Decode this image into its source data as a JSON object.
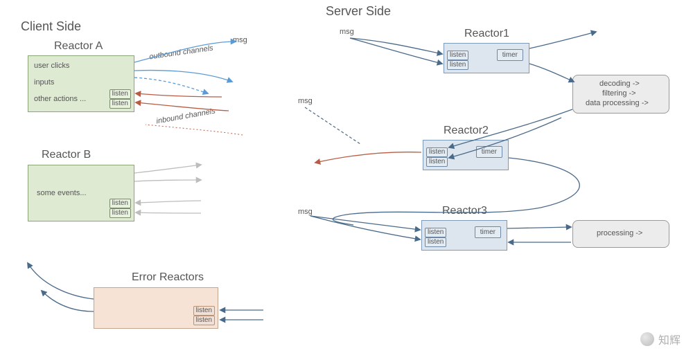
{
  "sections": {
    "client": "Client Side",
    "server": "Server Side"
  },
  "reactorA": {
    "label": "Reactor A",
    "events": [
      "user clicks",
      "inputs",
      "other actions ..."
    ],
    "listen": "listen",
    "outbound": "outbound channels",
    "inbound": "inbound channels",
    "msg": "msg"
  },
  "reactorB": {
    "label": "Reactor B",
    "events": "some events...",
    "listen": "listen"
  },
  "errorReactors": {
    "label": "Error Reactors",
    "listen": "listen"
  },
  "reactor1": {
    "label": "Reactor1",
    "listen": "listen",
    "timer": "timer",
    "msg": "msg"
  },
  "reactor2": {
    "label": "Reactor2",
    "listen": "listen",
    "timer": "timer",
    "msg": "msg"
  },
  "reactor3": {
    "label": "Reactor3",
    "listen": "listen",
    "timer": "timer",
    "msg": "msg"
  },
  "pipeline1": {
    "line1": "decoding ->",
    "line2": "filtering ->",
    "line3": "data processing ->"
  },
  "pipeline2": {
    "line1": "processing ->"
  },
  "watermark": "知辉"
}
